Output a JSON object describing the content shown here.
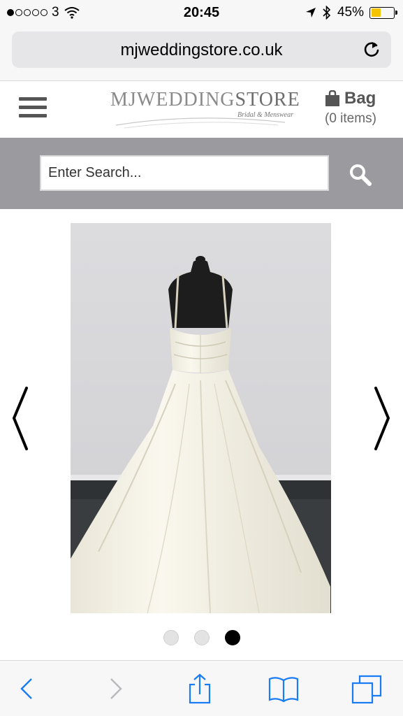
{
  "status_bar": {
    "carrier": "3",
    "time": "20:45",
    "battery": "45%",
    "battery_level": 0.45,
    "signal_bars": 1
  },
  "browser": {
    "url": "mjweddingstore.co.uk"
  },
  "site_header": {
    "logo_main_a": "MJWEDDING",
    "logo_main_b": "STORE",
    "logo_sub": "Bridal & Menswear",
    "bag_label": "Bag",
    "bag_count": "(0 items)"
  },
  "search": {
    "placeholder": "Enter Search..."
  },
  "gallery": {
    "image_count": 3,
    "active_index": 3
  },
  "colors": {
    "search_band": "#9b9b9f",
    "ios_blue": "#1a7cf5",
    "battery_fill": "#f5c400"
  }
}
